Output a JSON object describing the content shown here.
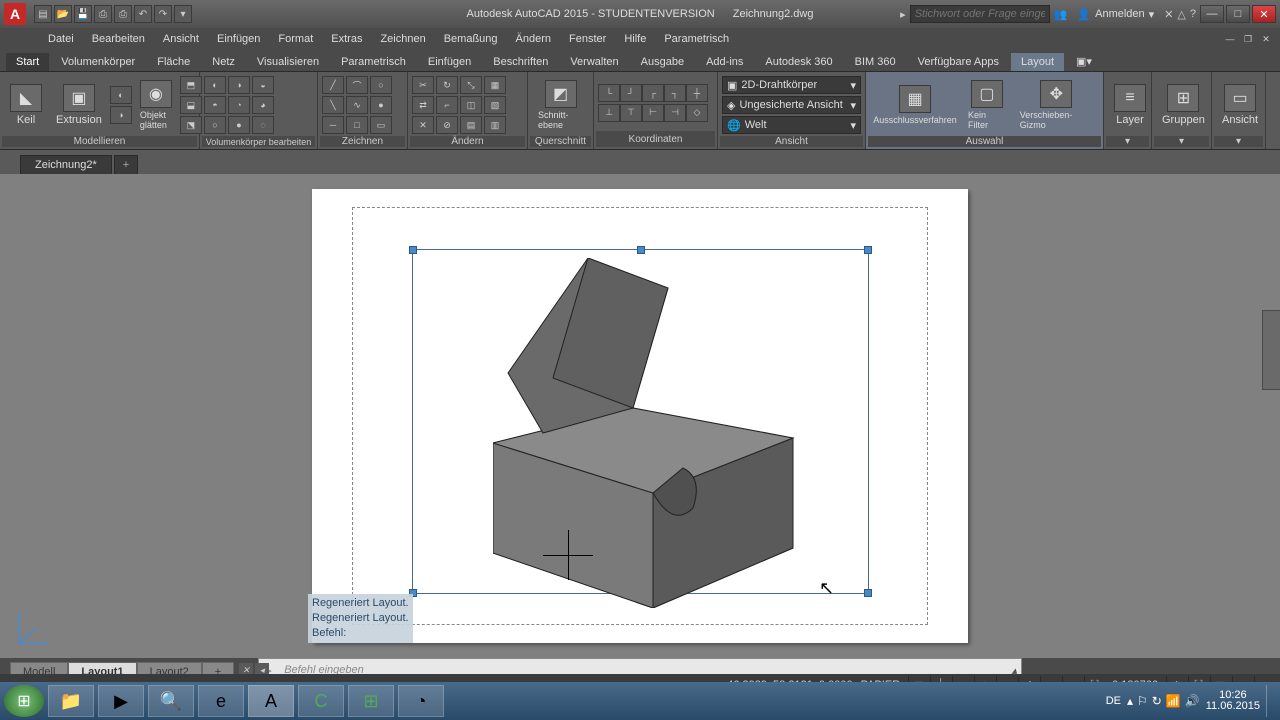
{
  "title": {
    "app": "Autodesk AutoCAD 2015 - STUDENTENVERSION",
    "doc": "Zeichnung2.dwg"
  },
  "search_placeholder": "Stichwort oder Frage eingeben",
  "user": "Anmelden",
  "menus": [
    "Datei",
    "Bearbeiten",
    "Ansicht",
    "Einfügen",
    "Format",
    "Extras",
    "Zeichnen",
    "Bemaßung",
    "Ändern",
    "Fenster",
    "Hilfe",
    "Parametrisch"
  ],
  "ribbon_tabs": [
    "Start",
    "Volumenkörper",
    "Fläche",
    "Netz",
    "Visualisieren",
    "Parametrisch",
    "Einfügen",
    "Beschriften",
    "Verwalten",
    "Ausgabe",
    "Add-ins",
    "Autodesk 360",
    "BIM 360",
    "Verfügbare Apps",
    "Layout"
  ],
  "active_ribbon_tab": 14,
  "panels": {
    "modellieren": {
      "label": "Modellieren",
      "btn1": "Keil",
      "btn2": "Extrusion",
      "btn3": "Objekt glätten"
    },
    "vk_bearbeiten": {
      "label": "Volumenkörper bearbeiten"
    },
    "zeichnen": {
      "label": "Zeichnen"
    },
    "aendern": {
      "label": "Ändern"
    },
    "querschnitt": {
      "label": "Querschnitt",
      "btn": "Schnitt-ebene"
    },
    "koordinaten": {
      "label": "Koordinaten"
    },
    "ansicht": {
      "label": "Ansicht",
      "combo1": "2D-Drahtkörper",
      "combo2": "Ungesicherte Ansicht",
      "combo3": "Welt"
    },
    "auswahl": {
      "label": "Auswahl",
      "btn1": "Ausschlussverfahren",
      "btn2": "Kein Filter",
      "btn3": "Verschieben-Gizmo"
    },
    "layer": {
      "label": "Layer"
    },
    "gruppen": {
      "label": "Gruppen"
    },
    "ansicht2": {
      "label": "Ansicht"
    }
  },
  "file_tab": "Zeichnung2*",
  "cmd_history": [
    "Regeneriert Layout.",
    "Regeneriert Layout.",
    "Befehl:"
  ],
  "cmd_placeholder": "Befehl eingeben",
  "layout_tabs": [
    "Modell",
    "Layout1",
    "Layout2"
  ],
  "active_layout": 1,
  "status": {
    "coords": "46.3939, 58.2121, 0.0000",
    "space": "PAPIER",
    "scale": "0.180766"
  },
  "tray": {
    "lang": "DE",
    "time": "10:26",
    "date": "11.06.2015"
  }
}
